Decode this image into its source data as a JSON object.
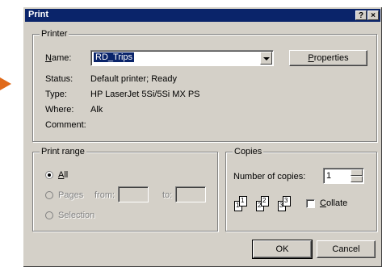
{
  "dialog": {
    "title": "Print",
    "help_button": "?",
    "close_button": "×"
  },
  "printer": {
    "group_label": "Printer",
    "name_label": "Name:",
    "name_value": "RD_Trips",
    "properties_button": "Properties",
    "status_label": "Status:",
    "status_value": "Default printer; Ready",
    "type_label": "Type:",
    "type_value": "HP LaserJet 5Si/5Si MX PS",
    "where_label": "Where:",
    "where_value": "Alk",
    "comment_label": "Comment:",
    "comment_value": ""
  },
  "print_range": {
    "group_label": "Print range",
    "all_label": "All",
    "pages_label": "Pages",
    "from_label": "from:",
    "to_label": "to:",
    "selection_label": "Selection",
    "selected": "All"
  },
  "copies": {
    "group_label": "Copies",
    "number_label": "Number of copies:",
    "number_value": "1",
    "collate_label": "Collate",
    "collate_checked": false,
    "page_icons": [
      "1",
      "1",
      "2",
      "2",
      "3",
      "3"
    ]
  },
  "buttons": {
    "ok": "OK",
    "cancel": "Cancel"
  },
  "colors": {
    "dialog_bg": "#d4d0c8",
    "title_bar": "#0a246a",
    "arrow": "#e06a1a"
  }
}
